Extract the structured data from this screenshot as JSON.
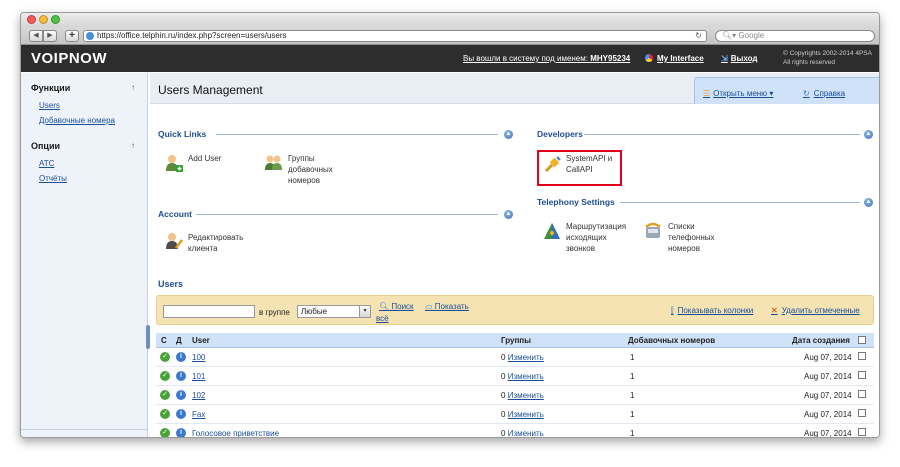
{
  "browser": {
    "url": "https://office.telphin.ru/index.php?screen=users/users",
    "search_placeholder": "Google"
  },
  "header": {
    "logo": "VOIPNOW",
    "logged_in_prefix": "Вы вошли в систему под именем:",
    "logged_in_user": "MHY95234",
    "my_interface": "My Interface",
    "exit": "Выход",
    "copyright_1": "© Copyrights 2002-2014 4PSA",
    "copyright_2": "All rights reserved"
  },
  "sidebar": {
    "functions_title": "Функции",
    "functions_items": [
      "Users",
      "Добавочные номера"
    ],
    "options_title": "Опции",
    "options_items": [
      "АТС",
      "Отчёты"
    ]
  },
  "main": {
    "title": "Users Management",
    "open_menu": "Открыть меню",
    "help": "Справка"
  },
  "quick_links": {
    "title": "Quick Links",
    "add_user": "Add User",
    "extension_groups": [
      "Группы",
      "добавочных",
      "номеров"
    ]
  },
  "developers": {
    "title": "Developers",
    "api": [
      "SystemAPI и",
      "CallAPI"
    ]
  },
  "account": {
    "title": "Account",
    "edit_client": [
      "Редактировать",
      "клиента"
    ]
  },
  "telephony": {
    "title": "Telephony Settings",
    "outgoing_routing": [
      "Маршрутизация",
      "исходящих",
      "звонков"
    ],
    "phone_lists": [
      "Списки",
      "телефонных",
      "номеров"
    ]
  },
  "users": {
    "title": "Users",
    "search_value": "",
    "in_group_label": "в группе",
    "group_selected": "Любые",
    "search_link": "Поиск",
    "show_all_link_1": "Показать",
    "show_all_link_2": "всё",
    "show_columns": "Показывать колонки",
    "delete_selected": "Удалить отмеченные",
    "columns": {
      "c": "С",
      "d": "Д",
      "user": "User",
      "groups": "Группы",
      "extensions": "Добавочных номеров",
      "created": "Дата создания"
    },
    "rows": [
      {
        "user": "100",
        "groups_count": "0",
        "groups_link": "Изменить",
        "extensions": "1",
        "created": "Aug 07, 2014"
      },
      {
        "user": "101",
        "groups_count": "0",
        "groups_link": "Изменить",
        "extensions": "1",
        "created": "Aug 07, 2014"
      },
      {
        "user": "102",
        "groups_count": "0",
        "groups_link": "Изменить",
        "extensions": "1",
        "created": "Aug 07, 2014"
      },
      {
        "user": "Fax",
        "groups_count": "0",
        "groups_link": "Изменить",
        "extensions": "1",
        "created": "Aug 07, 2014"
      },
      {
        "user": "Голосовое приветствие",
        "groups_count": "0",
        "groups_link": "Изменить",
        "extensions": "1",
        "created": "Aug 07, 2014"
      }
    ]
  },
  "colors": {
    "header_bg": "#2d2d2d",
    "link": "#1a4e99",
    "section_title": "#1d4f8f",
    "filter_bg": "#f5e3b3",
    "table_head_bg": "#cfe2f7",
    "highlight_border": "#e2001a"
  }
}
